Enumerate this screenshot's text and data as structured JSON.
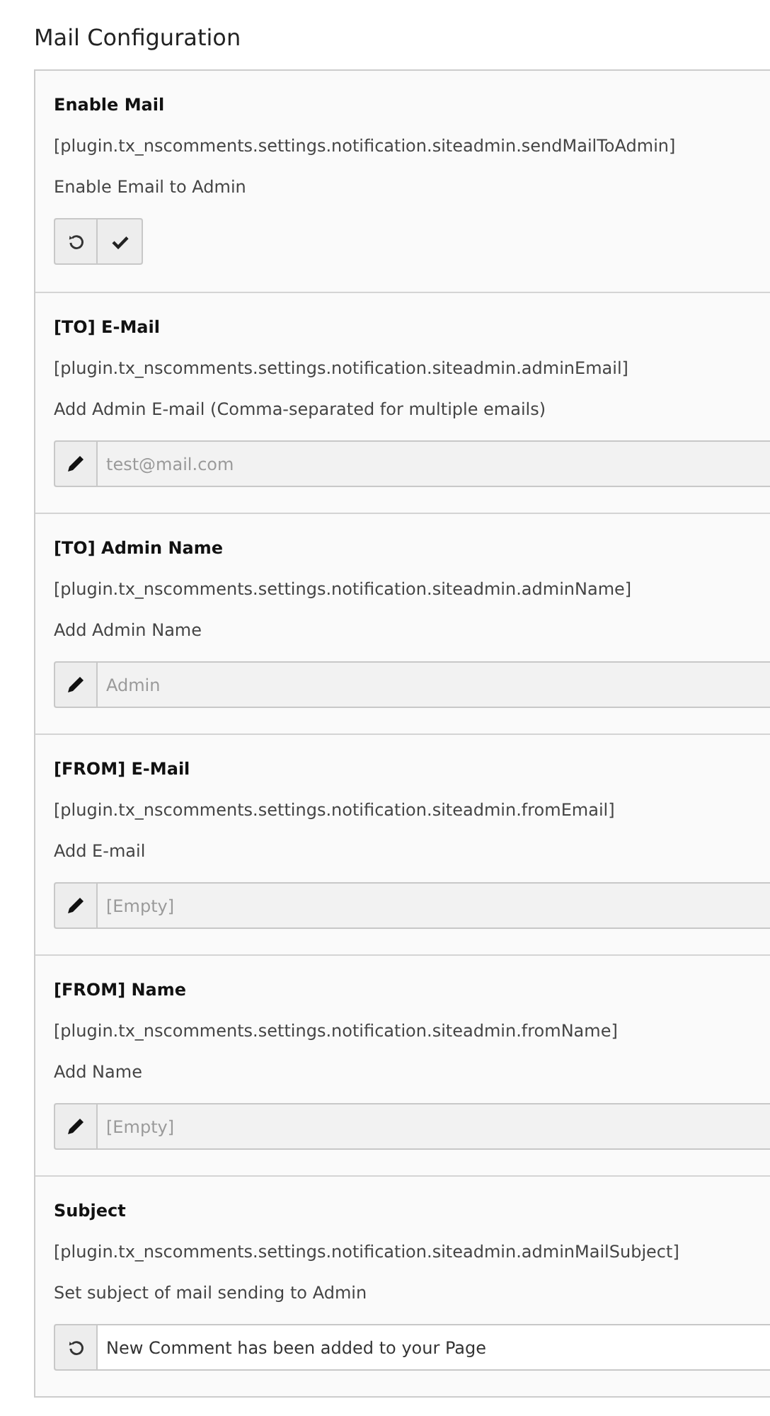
{
  "heading": "Mail Configuration",
  "settings": [
    {
      "title": "Enable Mail",
      "key": "[plugin.tx_nscomments.settings.notification.siteadmin.sendMailToAdmin]",
      "description": "Enable Email to Admin",
      "control": {
        "kind": "checkbox",
        "checked": true
      }
    },
    {
      "title": "[TO] E-Mail",
      "key": "[plugin.tx_nscomments.settings.notification.siteadmin.adminEmail]",
      "description": "Add Admin E-mail (Comma-separated for multiple emails)",
      "control": {
        "kind": "edit",
        "placeholder": "test@mail.com"
      }
    },
    {
      "title": "[TO] Admin Name",
      "key": "[plugin.tx_nscomments.settings.notification.siteadmin.adminName]",
      "description": "Add Admin Name",
      "control": {
        "kind": "edit",
        "placeholder": "Admin"
      }
    },
    {
      "title": "[FROM] E-Mail",
      "key": "[plugin.tx_nscomments.settings.notification.siteadmin.fromEmail]",
      "description": "Add E-mail",
      "control": {
        "kind": "edit",
        "placeholder": "[Empty]"
      }
    },
    {
      "title": "[FROM] Name",
      "key": "[plugin.tx_nscomments.settings.notification.siteadmin.fromName]",
      "description": "Add Name",
      "control": {
        "kind": "edit",
        "placeholder": "[Empty]"
      }
    },
    {
      "title": "Subject",
      "key": "[plugin.tx_nscomments.settings.notification.siteadmin.adminMailSubject]",
      "description": "Set subject of mail sending to Admin",
      "control": {
        "kind": "reset",
        "value": "New Comment has been added to your Page"
      }
    }
  ]
}
